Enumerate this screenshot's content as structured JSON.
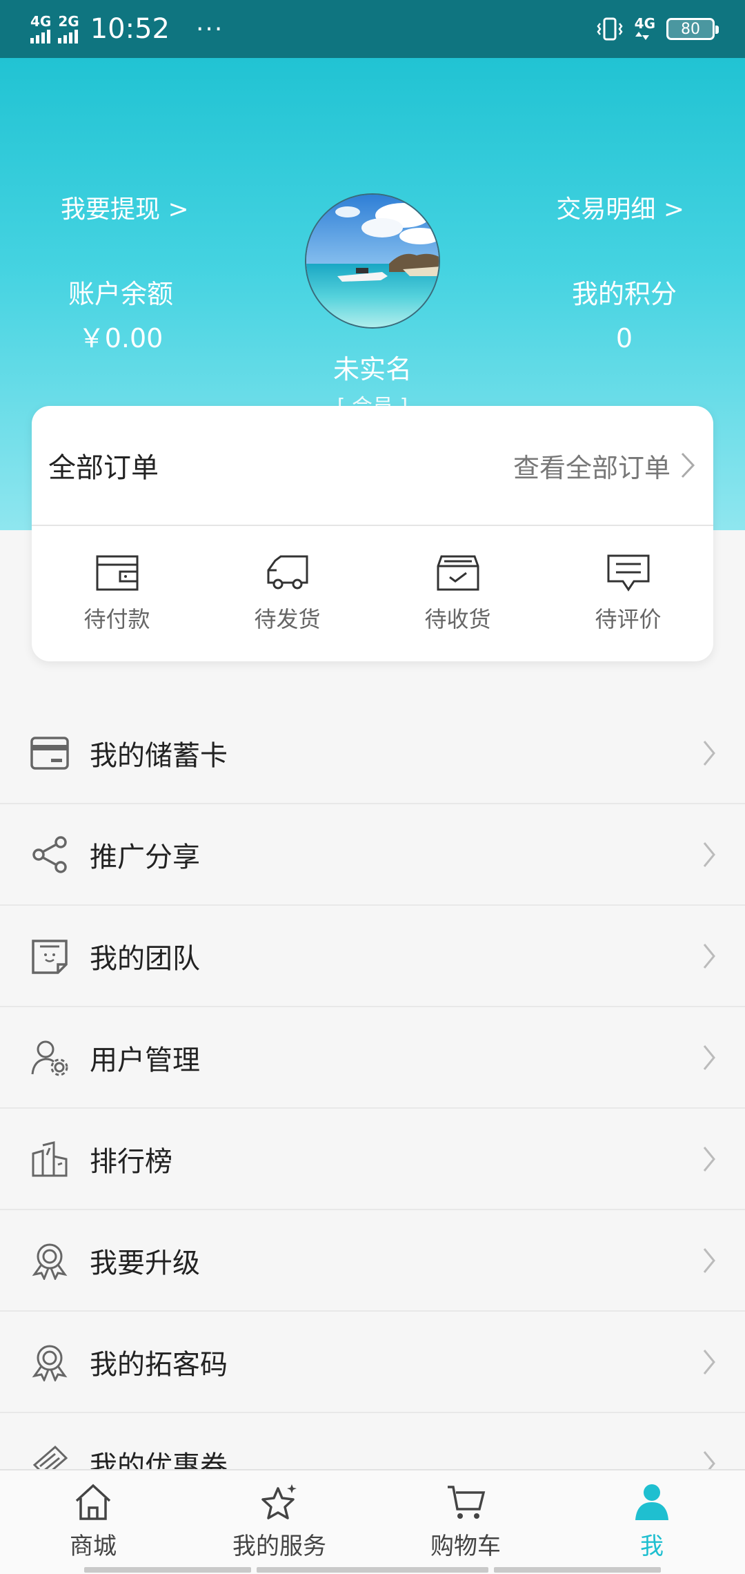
{
  "status_bar": {
    "net1": "4G",
    "net2": "2G",
    "time": "10:52",
    "more": "···",
    "net3": "4G",
    "battery": "80"
  },
  "header": {
    "withdraw_link": "我要提现 >",
    "transactions_link": "交易明细 >",
    "balance_label": "账户余额",
    "balance_value": "￥0.00",
    "points_label": "我的积分",
    "points_value": "0",
    "user_name": "未实名",
    "user_role": "[ 会员 ]"
  },
  "orders": {
    "title": "全部订单",
    "view_all": "查看全部订单",
    "items": [
      {
        "label": "待付款",
        "icon": "wallet-icon"
      },
      {
        "label": "待发货",
        "icon": "truck-icon"
      },
      {
        "label": "待收货",
        "icon": "inbox-check-icon"
      },
      {
        "label": "待评价",
        "icon": "comment-icon"
      }
    ]
  },
  "menu": [
    {
      "label": "我的储蓄卡",
      "icon": "card-icon"
    },
    {
      "label": "推广分享",
      "icon": "share-icon"
    },
    {
      "label": "我的团队",
      "icon": "team-icon"
    },
    {
      "label": "用户管理",
      "icon": "user-settings-icon"
    },
    {
      "label": "排行榜",
      "icon": "ranking-icon"
    },
    {
      "label": "我要升级",
      "icon": "medal-icon"
    },
    {
      "label": "我的拓客码",
      "icon": "medal-icon"
    },
    {
      "label": "我的优惠券",
      "icon": "coupon-icon"
    }
  ],
  "tabbar": [
    {
      "label": "商城",
      "icon": "home-icon"
    },
    {
      "label": "我的服务",
      "icon": "star-icon"
    },
    {
      "label": "购物车",
      "icon": "cart-icon"
    },
    {
      "label": "我",
      "icon": "person-icon",
      "active": true
    }
  ],
  "colors": {
    "status_bar": "#0f7580",
    "header_top": "#21c3d3",
    "accent": "#1fbfd0"
  }
}
